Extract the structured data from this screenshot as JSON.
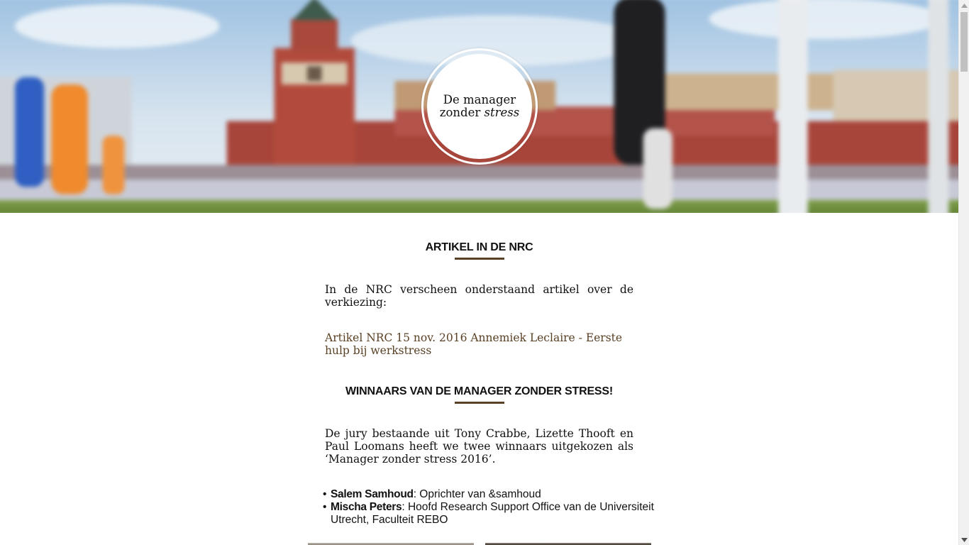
{
  "hero": {
    "logo_line1": "De manager",
    "logo_line2_prefix": "zonder ",
    "logo_line2_emphasis": "stress"
  },
  "section_nrc": {
    "heading": "ARTIKEL IN DE NRC",
    "intro": "In de NRC verscheen onderstaand artikel over de verkiezing:",
    "link_text": "Artikel NRC 15 nov. 2016 Annemiek Leclaire - Eerste hulp bij werkstress"
  },
  "section_winners": {
    "heading": "WINNAARS VAN DE MANAGER ZONDER STRESS!",
    "intro": "De jury bestaande uit Tony Crabbe, Lizette Thooft en Paul Loomans heeft we twee winnaars uitgekozen als ‘Manager zonder stress 2016’.",
    "winners": [
      {
        "name": "Salem Samhoud",
        "description": ": Oprichter van &samhoud"
      },
      {
        "name": "Mischa Peters",
        "description": ": Hoofd Research Support Office van de Universiteit Utrecht, Faculteit REBO"
      }
    ]
  },
  "colors": {
    "accent": "#5a4125",
    "text": "#111111",
    "background": "#ffffff"
  },
  "icons": {
    "scroll_up": "chevron-up-icon",
    "scroll_down": "chevron-down-icon"
  }
}
